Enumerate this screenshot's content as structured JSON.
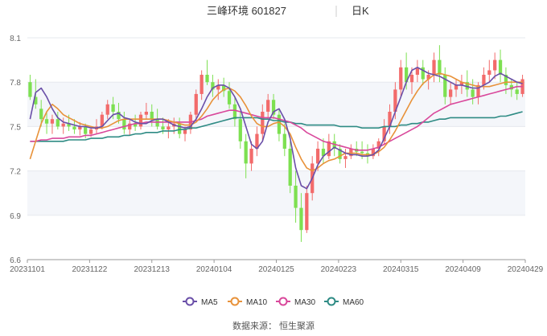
{
  "header": {
    "title": "三峰环境 601827",
    "period": "日K"
  },
  "source": "数据来源： 恒生聚源",
  "colors": {
    "up": "#f26b6b",
    "down": "#7de051",
    "ma5": "#6a4fa8",
    "ma10": "#e8923a",
    "ma30": "#d9489b",
    "ma60": "#2e8b84"
  },
  "chart_data": {
    "type": "candlestick",
    "ylim": [
      6.6,
      8.1
    ],
    "yticks": [
      "6.6",
      "6.9",
      "7.2",
      "7.5",
      "7.8",
      "8.1"
    ],
    "xticks": [
      "20231101",
      "20231122",
      "20231213",
      "20240104",
      "20240125",
      "20240223",
      "20240315",
      "20240409",
      "20240429"
    ],
    "legend": [
      "MA5",
      "MA10",
      "MA30",
      "MA60"
    ],
    "legend_position": "bottom",
    "candles_ohlc": [
      [
        7.8,
        7.85,
        7.68,
        7.7
      ],
      [
        7.7,
        7.82,
        7.62,
        7.65
      ],
      [
        7.62,
        7.68,
        7.5,
        7.55
      ],
      [
        7.55,
        7.6,
        7.45,
        7.52
      ],
      [
        7.52,
        7.58,
        7.45,
        7.55
      ],
      [
        7.55,
        7.6,
        7.48,
        7.5
      ],
      [
        7.5,
        7.56,
        7.45,
        7.52
      ],
      [
        7.52,
        7.58,
        7.47,
        7.5
      ],
      [
        7.5,
        7.55,
        7.45,
        7.48
      ],
      [
        7.48,
        7.53,
        7.44,
        7.5
      ],
      [
        7.5,
        7.52,
        7.42,
        7.45
      ],
      [
        7.45,
        7.5,
        7.43,
        7.48
      ],
      [
        7.48,
        7.55,
        7.45,
        7.5
      ],
      [
        7.5,
        7.6,
        7.48,
        7.58
      ],
      [
        7.58,
        7.68,
        7.55,
        7.65
      ],
      [
        7.65,
        7.7,
        7.55,
        7.6
      ],
      [
        7.6,
        7.66,
        7.52,
        7.55
      ],
      [
        7.55,
        7.6,
        7.45,
        7.48
      ],
      [
        7.48,
        7.55,
        7.44,
        7.52
      ],
      [
        7.52,
        7.58,
        7.47,
        7.5
      ],
      [
        7.5,
        7.6,
        7.48,
        7.58
      ],
      [
        7.58,
        7.66,
        7.55,
        7.6
      ],
      [
        7.6,
        7.65,
        7.5,
        7.55
      ],
      [
        7.55,
        7.62,
        7.48,
        7.5
      ],
      [
        7.5,
        7.56,
        7.45,
        7.48
      ],
      [
        7.48,
        7.55,
        7.42,
        7.5
      ],
      [
        7.5,
        7.56,
        7.45,
        7.52
      ],
      [
        7.52,
        7.56,
        7.42,
        7.45
      ],
      [
        7.45,
        7.5,
        7.4,
        7.48
      ],
      [
        7.48,
        7.6,
        7.45,
        7.58
      ],
      [
        7.58,
        7.75,
        7.55,
        7.72
      ],
      [
        7.72,
        7.88,
        7.68,
        7.85
      ],
      [
        7.85,
        7.95,
        7.78,
        7.8
      ],
      [
        7.8,
        7.85,
        7.7,
        7.75
      ],
      [
        7.75,
        7.82,
        7.68,
        7.78
      ],
      [
        7.78,
        7.83,
        7.7,
        7.74
      ],
      [
        7.74,
        7.8,
        7.62,
        7.65
      ],
      [
        7.65,
        7.7,
        7.5,
        7.55
      ],
      [
        7.55,
        7.6,
        7.35,
        7.4
      ],
      [
        7.4,
        7.45,
        7.15,
        7.25
      ],
      [
        7.25,
        7.4,
        7.2,
        7.35
      ],
      [
        7.35,
        7.5,
        7.3,
        7.45
      ],
      [
        7.45,
        7.65,
        7.4,
        7.6
      ],
      [
        7.6,
        7.72,
        7.55,
        7.68
      ],
      [
        7.68,
        7.72,
        7.55,
        7.58
      ],
      [
        7.58,
        7.62,
        7.4,
        7.45
      ],
      [
        7.45,
        7.52,
        7.3,
        7.35
      ],
      [
        7.35,
        7.4,
        7.05,
        7.1
      ],
      [
        7.1,
        7.2,
        6.85,
        6.95
      ],
      [
        6.95,
        7.05,
        6.72,
        6.8
      ],
      [
        6.8,
        7.1,
        6.78,
        7.05
      ],
      [
        7.05,
        7.3,
        7.0,
        7.25
      ],
      [
        7.25,
        7.4,
        7.2,
        7.35
      ],
      [
        7.35,
        7.42,
        7.25,
        7.3
      ],
      [
        7.3,
        7.45,
        7.28,
        7.4
      ],
      [
        7.4,
        7.45,
        7.3,
        7.35
      ],
      [
        7.35,
        7.38,
        7.25,
        7.28
      ],
      [
        7.28,
        7.35,
        7.22,
        7.3
      ],
      [
        7.3,
        7.38,
        7.28,
        7.35
      ],
      [
        7.35,
        7.4,
        7.3,
        7.33
      ],
      [
        7.33,
        7.4,
        7.28,
        7.32
      ],
      [
        7.32,
        7.38,
        7.25,
        7.3
      ],
      [
        7.3,
        7.38,
        7.28,
        7.35
      ],
      [
        7.35,
        7.42,
        7.3,
        7.4
      ],
      [
        7.4,
        7.55,
        7.38,
        7.5
      ],
      [
        7.5,
        7.65,
        7.45,
        7.6
      ],
      [
        7.6,
        7.8,
        7.55,
        7.75
      ],
      [
        7.75,
        7.95,
        7.7,
        7.9
      ],
      [
        7.9,
        8.0,
        7.75,
        7.8
      ],
      [
        7.8,
        7.9,
        7.72,
        7.85
      ],
      [
        7.85,
        7.95,
        7.8,
        7.9
      ],
      [
        7.9,
        7.95,
        7.78,
        7.82
      ],
      [
        7.82,
        7.88,
        7.75,
        7.85
      ],
      [
        7.85,
        8.0,
        7.8,
        7.95
      ],
      [
        7.95,
        8.05,
        7.8,
        7.85
      ],
      [
        7.85,
        7.9,
        7.65,
        7.7
      ],
      [
        7.7,
        7.8,
        7.65,
        7.75
      ],
      [
        7.75,
        7.82,
        7.7,
        7.78
      ],
      [
        7.78,
        7.85,
        7.72,
        7.8
      ],
      [
        7.8,
        7.88,
        7.7,
        7.75
      ],
      [
        7.75,
        7.82,
        7.65,
        7.7
      ],
      [
        7.7,
        7.8,
        7.65,
        7.78
      ],
      [
        7.78,
        7.9,
        7.75,
        7.85
      ],
      [
        7.85,
        7.95,
        7.8,
        7.88
      ],
      [
        7.88,
        8.0,
        7.82,
        7.95
      ],
      [
        7.95,
        8.02,
        7.8,
        7.85
      ],
      [
        7.85,
        7.9,
        7.72,
        7.78
      ],
      [
        7.78,
        7.82,
        7.7,
        7.75
      ],
      [
        7.75,
        7.8,
        7.68,
        7.72
      ],
      [
        7.72,
        7.85,
        7.7,
        7.82
      ]
    ],
    "ma5": [
      7.55,
      7.73,
      7.76,
      7.7,
      7.62,
      7.56,
      7.53,
      7.52,
      7.51,
      7.5,
      7.5,
      7.49,
      7.49,
      7.5,
      7.54,
      7.58,
      7.59,
      7.56,
      7.55,
      7.53,
      7.52,
      7.52,
      7.54,
      7.55,
      7.55,
      7.53,
      7.51,
      7.5,
      7.49,
      7.5,
      7.55,
      7.62,
      7.7,
      7.76,
      7.78,
      7.78,
      7.76,
      7.7,
      7.62,
      7.5,
      7.38,
      7.35,
      7.4,
      7.53,
      7.6,
      7.62,
      7.55,
      7.42,
      7.22,
      7.1,
      7.08,
      7.15,
      7.24,
      7.3,
      7.33,
      7.36,
      7.34,
      7.32,
      7.31,
      7.31,
      7.3,
      7.3,
      7.31,
      7.34,
      7.42,
      7.5,
      7.6,
      7.7,
      7.8,
      7.88,
      7.9,
      7.88,
      7.86,
      7.85,
      7.84,
      7.82,
      7.8,
      7.78,
      7.78,
      7.77,
      7.76,
      7.76,
      7.78,
      7.8,
      7.84,
      7.86,
      7.84,
      7.82,
      7.8,
      7.79
    ],
    "ma10": [
      7.28,
      7.4,
      7.52,
      7.6,
      7.65,
      7.62,
      7.58,
      7.56,
      7.54,
      7.52,
      7.51,
      7.5,
      7.49,
      7.49,
      7.5,
      7.52,
      7.54,
      7.55,
      7.55,
      7.55,
      7.55,
      7.55,
      7.55,
      7.55,
      7.55,
      7.54,
      7.53,
      7.52,
      7.51,
      7.51,
      7.53,
      7.57,
      7.62,
      7.68,
      7.72,
      7.75,
      7.76,
      7.74,
      7.7,
      7.64,
      7.57,
      7.52,
      7.5,
      7.5,
      7.52,
      7.53,
      7.5,
      7.45,
      7.36,
      7.28,
      7.22,
      7.2,
      7.22,
      7.25,
      7.27,
      7.28,
      7.3,
      7.32,
      7.32,
      7.32,
      7.31,
      7.31,
      7.31,
      7.33,
      7.36,
      7.41,
      7.47,
      7.54,
      7.61,
      7.68,
      7.74,
      7.79,
      7.82,
      7.85,
      7.86,
      7.85,
      7.84,
      7.82,
      7.8,
      7.79,
      7.78,
      7.77,
      7.77,
      7.77,
      7.78,
      7.79,
      7.8,
      7.8,
      7.8,
      7.8
    ],
    "ma30": [
      7.4,
      7.4,
      7.41,
      7.41,
      7.42,
      7.42,
      7.42,
      7.43,
      7.43,
      7.43,
      7.44,
      7.44,
      7.45,
      7.46,
      7.47,
      7.48,
      7.49,
      7.5,
      7.51,
      7.52,
      7.52,
      7.53,
      7.53,
      7.53,
      7.53,
      7.53,
      7.53,
      7.53,
      7.53,
      7.53,
      7.54,
      7.55,
      7.57,
      7.58,
      7.59,
      7.6,
      7.61,
      7.61,
      7.6,
      7.59,
      7.58,
      7.57,
      7.56,
      7.56,
      7.56,
      7.55,
      7.54,
      7.53,
      7.51,
      7.49,
      7.46,
      7.44,
      7.42,
      7.4,
      7.39,
      7.38,
      7.37,
      7.36,
      7.35,
      7.34,
      7.34,
      7.34,
      7.35,
      7.36,
      7.38,
      7.4,
      7.42,
      7.44,
      7.46,
      7.48,
      7.5,
      7.53,
      7.56,
      7.59,
      7.61,
      7.63,
      7.65,
      7.66,
      7.67,
      7.68,
      7.69,
      7.7,
      7.71,
      7.72,
      7.73,
      7.74,
      7.75,
      7.76,
      7.77,
      7.77
    ],
    "ma60": [
      7.4,
      7.4,
      7.4,
      7.4,
      7.4,
      7.4,
      7.4,
      7.41,
      7.41,
      7.41,
      7.41,
      7.42,
      7.42,
      7.42,
      7.43,
      7.43,
      7.43,
      7.44,
      7.44,
      7.45,
      7.45,
      7.46,
      7.46,
      7.46,
      7.47,
      7.47,
      7.47,
      7.48,
      7.48,
      7.49,
      7.49,
      7.5,
      7.51,
      7.52,
      7.53,
      7.54,
      7.55,
      7.56,
      7.56,
      7.56,
      7.56,
      7.56,
      7.55,
      7.55,
      7.54,
      7.54,
      7.53,
      7.53,
      7.52,
      7.52,
      7.51,
      7.51,
      7.51,
      7.51,
      7.51,
      7.51,
      7.5,
      7.5,
      7.5,
      7.5,
      7.49,
      7.49,
      7.49,
      7.49,
      7.5,
      7.5,
      7.5,
      7.51,
      7.51,
      7.52,
      7.52,
      7.53,
      7.53,
      7.54,
      7.55,
      7.55,
      7.56,
      7.56,
      7.56,
      7.56,
      7.56,
      7.56,
      7.56,
      7.56,
      7.56,
      7.57,
      7.57,
      7.58,
      7.59,
      7.6
    ]
  }
}
